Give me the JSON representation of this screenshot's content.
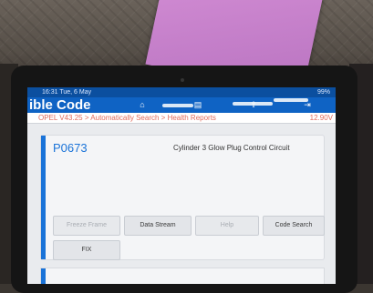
{
  "status_bar": {
    "time": "16:31",
    "date": "Tue, 6 May",
    "battery": "99%"
  },
  "header": {
    "title": "ible Code",
    "icons": [
      "home-icon",
      "report-icon",
      "upload-icon",
      "exit-icon"
    ]
  },
  "breadcrumb": {
    "text": "OPEL V43.25 > Automatically Search > Health Reports",
    "voltage": "12.90V"
  },
  "dtc": {
    "code": "P0673",
    "description": "Cylinder 3 Glow Plug Control Circuit",
    "buttons": {
      "freeze_frame": "Freeze Frame",
      "data_stream": "Data Stream",
      "help": "Help",
      "code_search": "Code Search",
      "fix": "FIX"
    }
  },
  "colors": {
    "accent": "#1a73d8",
    "header": "#0f63c4",
    "breadcrumb": "#e16b5c",
    "paper": "#c884cc"
  }
}
